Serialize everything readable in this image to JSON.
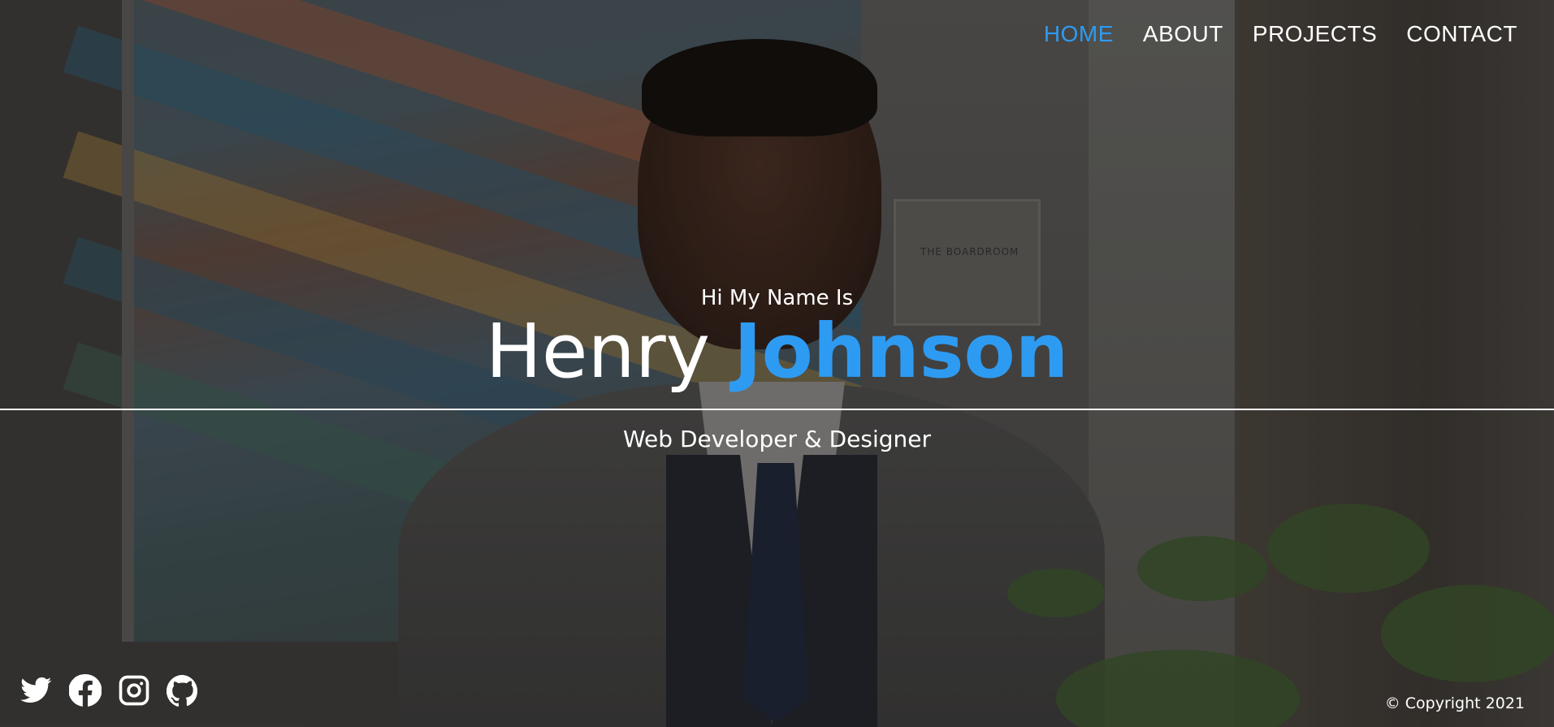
{
  "nav": {
    "items": [
      {
        "label": "HOME",
        "active": true
      },
      {
        "label": "ABOUT",
        "active": false
      },
      {
        "label": "PROJECTS",
        "active": false
      },
      {
        "label": "CONTACT",
        "active": false
      }
    ]
  },
  "hero": {
    "greeting": "Hi My Name Is",
    "first_name": "Henry",
    "last_name": "Johnson",
    "tagline": "Web Developer & Designer"
  },
  "social": {
    "icons": [
      "twitter-icon",
      "facebook-icon",
      "instagram-icon",
      "github-icon"
    ]
  },
  "footer": {
    "copyright": "© Copyright 2021"
  },
  "colors": {
    "accent": "#2e9bf2",
    "text": "#ffffff"
  }
}
